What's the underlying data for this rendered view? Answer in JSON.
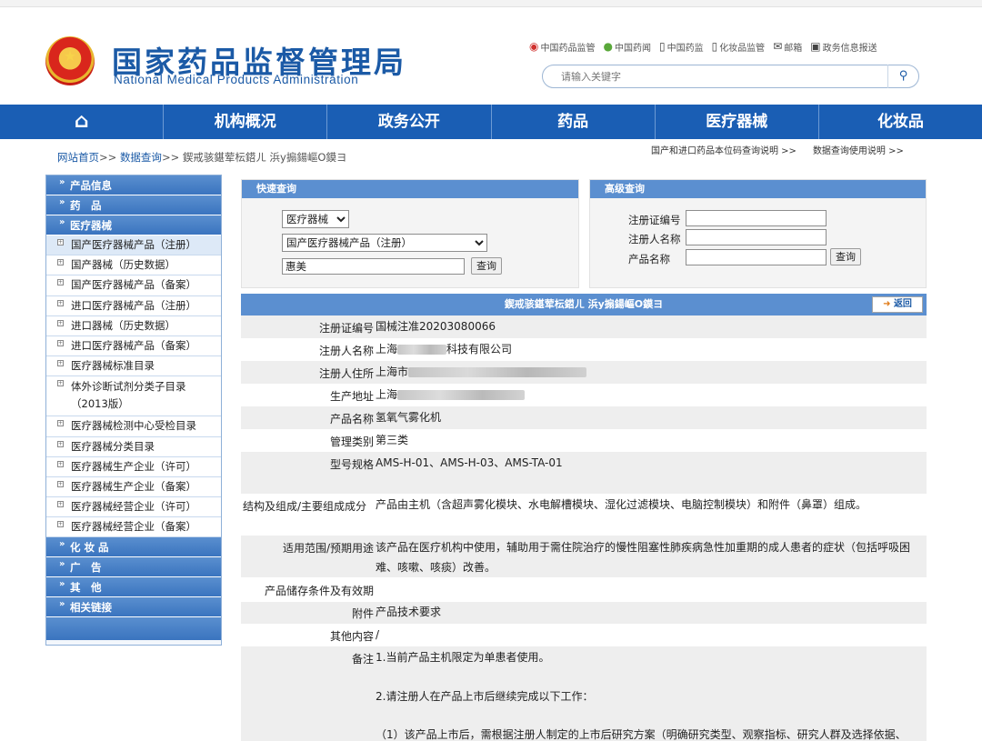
{
  "header": {
    "title": "国家药品监督管理局",
    "subtitle": "National Medical Products Administration",
    "top_links": [
      {
        "icon": "weibo-icon",
        "label": "中国药品监管"
      },
      {
        "icon": "wechat-icon",
        "label": "中国药闻"
      },
      {
        "icon": "phone-icon",
        "label": "中国药监"
      },
      {
        "icon": "phone-icon",
        "label": "化妆品监管"
      },
      {
        "icon": "mail-icon",
        "label": "邮箱"
      },
      {
        "icon": "monitor-icon",
        "label": "政务信息报送"
      }
    ],
    "search": {
      "placeholder": "请输入关键字"
    }
  },
  "nav": {
    "items": [
      "机构概况",
      "政务公开",
      "药品",
      "医疗器械",
      "化妆品"
    ]
  },
  "breadcrumb": {
    "home": "网站首页",
    "sep": ">>",
    "data_query": "数据查询",
    "current": "鍥戒骇鍖荤枟鍣ㄦ  浜у搧鍚嶇О鏌ヨ"
  },
  "right_links": [
    "国产和进口药品本位码查询说明 >>",
    "数据查询使用说明 >>"
  ],
  "sidebar": {
    "heads_top": [
      "产品信息",
      "药　品",
      "医疗器械"
    ],
    "items": [
      "国产医疗器械产品（注册）",
      "国产器械（历史数据）",
      "国产医疗器械产品（备案）",
      "进口医疗器械产品（注册）",
      "进口器械（历史数据）",
      "进口医疗器械产品（备案）",
      "医疗器械标准目录",
      "体外诊断试剂分类子目录（2013版）",
      "医疗器械检测中心受检目录",
      "医疗器械分类目录",
      "医疗器械生产企业（许可）",
      "医疗器械生产企业（备案）",
      "医疗器械经营企业（许可）",
      "医疗器械经营企业（备案）"
    ],
    "heads_bottom": [
      "化 妆 品",
      "广　告",
      "其　他",
      "相关链接"
    ]
  },
  "quick_query": {
    "title": "快速查询",
    "category": "医疗器械",
    "subcategory": "国产医疗器械产品（注册）",
    "keyword": "惠美",
    "button": "查询"
  },
  "advanced_query": {
    "title": "高级查询",
    "labels": [
      "注册证编号",
      "注册人名称",
      "产品名称"
    ],
    "button": "查询"
  },
  "detail": {
    "title": "鍥戒骇鍖荤枟鍣ㄦ  浜у搧鍚嶇О鏌ヨ",
    "back": "返回",
    "rows": {
      "reg_no": {
        "k": "注册证编号",
        "v": "国械注准20203080066"
      },
      "registrant": {
        "k": "注册人名称",
        "v_a": "上海",
        "v_b": "科技有限公司"
      },
      "address": {
        "k": "注册人住所",
        "v": "上海市"
      },
      "production": {
        "k": "生产地址",
        "v": "上海"
      },
      "product": {
        "k": "产品名称",
        "v": "氢氧气雾化机"
      },
      "class": {
        "k": "管理类别",
        "v": "第三类"
      },
      "model": {
        "k": "型号规格",
        "v": "AMS-H-01、AMS-H-03、AMS-TA-01"
      },
      "structure": {
        "k": "结构及组成/主要组成成分",
        "v": "产品由主机（含超声雾化模块、水电解槽模块、湿化过滤模块、电脑控制模块）和附件（鼻罩）组成。"
      },
      "scope": {
        "k": "适用范围/预期用途",
        "v": "该产品在医疗机构中使用，辅助用于需住院治疗的慢性阻塞性肺疾病急性加重期的成人患者的症状（包括呼吸困难、咳嗽、咳痰）改善。"
      },
      "storage": {
        "k": "产品储存条件及有效期",
        "v": ""
      },
      "attachment": {
        "k": "附件",
        "v": "产品技术要求"
      },
      "other": {
        "k": "其他内容",
        "v": "/"
      },
      "remark": {
        "k": "备注",
        "l1": "1.当前产品主机限定为单患者使用。",
        "l2": "2.请注册人在产品上市后继续完成以下工作：",
        "l3": "（1）该产品上市后，需根据注册人制定的上市后研究方案（明确研究类型、观察指标、研究人群及选择依据、"
      }
    }
  }
}
